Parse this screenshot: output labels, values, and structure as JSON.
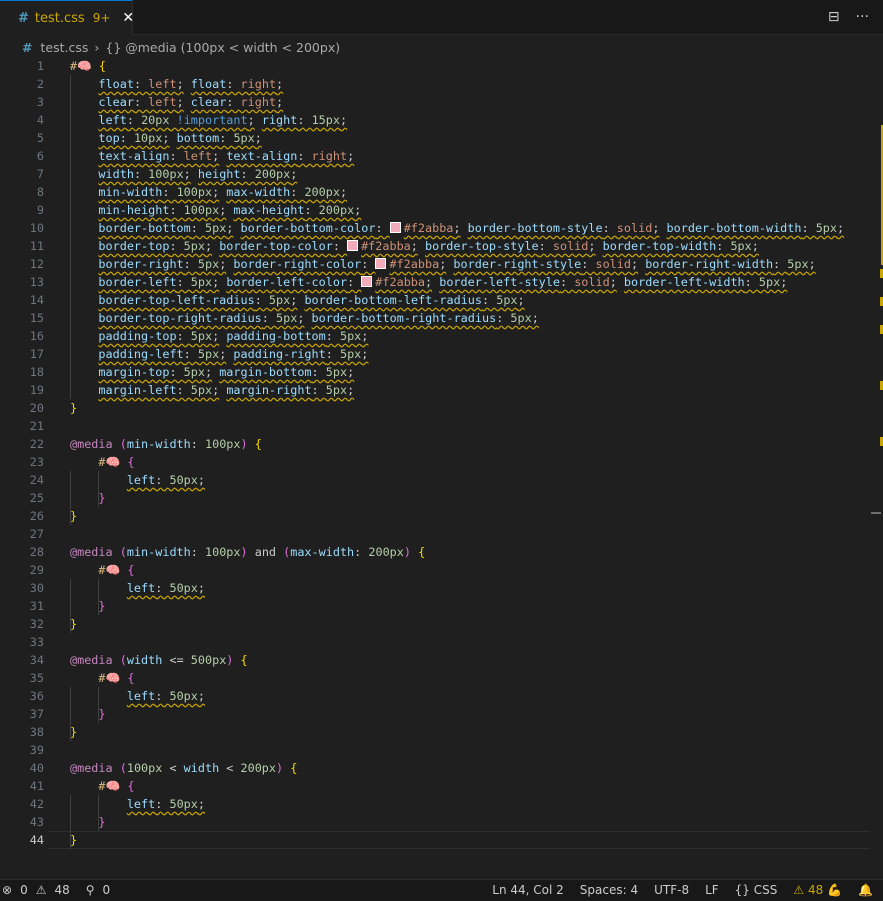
{
  "tab": {
    "icon": "#",
    "filename": "test.css",
    "problems": "9+",
    "close": "✕"
  },
  "tab_actions": {
    "split": "⊟",
    "more": "···"
  },
  "breadcrumb": {
    "file_icon": "#",
    "file": "test.css",
    "sep": "›",
    "symbol": "{} @media (100px < width < 200px)"
  },
  "lines": [
    "1",
    "2",
    "3",
    "4",
    "5",
    "6",
    "7",
    "8",
    "9",
    "10",
    "11",
    "12",
    "13",
    "14",
    "15",
    "16",
    "17",
    "18",
    "19",
    "20",
    "21",
    "22",
    "23",
    "24",
    "25",
    "26",
    "27",
    "28",
    "29",
    "30",
    "31",
    "32",
    "33",
    "34",
    "35",
    "36",
    "37",
    "38",
    "39",
    "40",
    "41",
    "42",
    "43",
    "44"
  ],
  "code": {
    "sel": "#🧠",
    "open": "{",
    "close": "}",
    "l2": [
      "float",
      "left",
      "float",
      "right"
    ],
    "l3": [
      "clear",
      "left",
      "clear",
      "right"
    ],
    "l4": [
      "left",
      "20px",
      "!important",
      "right",
      "15px"
    ],
    "l5": [
      "top",
      "10px",
      "bottom",
      "5px"
    ],
    "l6": [
      "text-align",
      "left",
      "text-align",
      "right"
    ],
    "l7": [
      "width",
      "100px",
      "height",
      "200px"
    ],
    "l8": [
      "min-width",
      "100px",
      "max-width",
      "200px"
    ],
    "l9": [
      "min-height",
      "100px",
      "max-height",
      "200px"
    ],
    "l10": [
      "border-bottom",
      "5px",
      "border-bottom-color",
      "#f2abba",
      "border-bottom-style",
      "solid",
      "border-bottom-width",
      "5px"
    ],
    "l11": [
      "border-top",
      "5px",
      "border-top-color",
      "#f2abba",
      "border-top-style",
      "solid",
      "border-top-width",
      "5px"
    ],
    "l12": [
      "border-right",
      "5px",
      "border-right-color",
      "#f2abba",
      "border-right-style",
      "solid",
      "border-right-width",
      "5px"
    ],
    "l13": [
      "border-left",
      "5px",
      "border-left-color",
      "#f2abba",
      "border-left-style",
      "solid",
      "border-left-width",
      "5px"
    ],
    "l14": [
      "border-top-left-radius",
      "5px",
      "border-bottom-left-radius",
      "5px"
    ],
    "l15": [
      "border-top-right-radius",
      "5px",
      "border-bottom-right-radius",
      "5px"
    ],
    "l16": [
      "padding-top",
      "5px",
      "padding-bottom",
      "5px"
    ],
    "l17": [
      "padding-left",
      "5px",
      "padding-right",
      "5px"
    ],
    "l18": [
      "margin-top",
      "5px",
      "margin-bottom",
      "5px"
    ],
    "l19": [
      "margin-left",
      "5px",
      "margin-right",
      "5px"
    ],
    "media": "@media",
    "m1": [
      "(",
      "min-width",
      "100px",
      ")"
    ],
    "m2": [
      "(",
      "min-width",
      "100px",
      ")",
      "and",
      "(",
      "max-width",
      "200px",
      ")"
    ],
    "m3": [
      "(",
      "width",
      "<=",
      "500px",
      ")"
    ],
    "m4": [
      "(",
      "100px",
      "<",
      "width",
      "<",
      "200px",
      ")"
    ],
    "inner": [
      "left",
      "50px"
    ]
  },
  "status": {
    "errors": "0",
    "warnings": "48",
    "ports": "0",
    "position": "Ln 44, Col 2",
    "spaces": "Spaces: 4",
    "encoding": "UTF-8",
    "eol": "LF",
    "language": "CSS",
    "lint_warnings": "48",
    "lint_emoji": "💪"
  },
  "colors": {
    "accent": "#0078d4",
    "warning": "#cca700",
    "swatch": "#f2abba"
  }
}
